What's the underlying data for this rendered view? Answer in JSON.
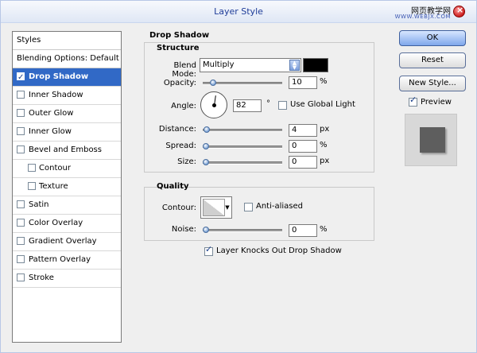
{
  "window": {
    "title": "Layer Style"
  },
  "watermark": {
    "chinese_text": "网页教学网",
    "url_text": "WWW.WEBJX.COM"
  },
  "styles_panel": {
    "header": "Styles",
    "blending_options": "Blending Options: Default",
    "items": [
      {
        "label": "Drop Shadow",
        "checked": true,
        "selected": true,
        "indent": false
      },
      {
        "label": "Inner Shadow",
        "checked": false,
        "selected": false,
        "indent": false
      },
      {
        "label": "Outer Glow",
        "checked": false,
        "selected": false,
        "indent": false
      },
      {
        "label": "Inner Glow",
        "checked": false,
        "selected": false,
        "indent": false
      },
      {
        "label": "Bevel and Emboss",
        "checked": false,
        "selected": false,
        "indent": false
      },
      {
        "label": "Contour",
        "checked": false,
        "selected": false,
        "indent": true
      },
      {
        "label": "Texture",
        "checked": false,
        "selected": false,
        "indent": true
      },
      {
        "label": "Satin",
        "checked": false,
        "selected": false,
        "indent": false
      },
      {
        "label": "Color Overlay",
        "checked": false,
        "selected": false,
        "indent": false
      },
      {
        "label": "Gradient Overlay",
        "checked": false,
        "selected": false,
        "indent": false
      },
      {
        "label": "Pattern Overlay",
        "checked": false,
        "selected": false,
        "indent": false
      },
      {
        "label": "Stroke",
        "checked": false,
        "selected": false,
        "indent": false
      }
    ]
  },
  "drop_shadow": {
    "title": "Drop Shadow",
    "structure": {
      "title": "Structure",
      "blend_mode": {
        "label": "Blend Mode:",
        "value": "Multiply"
      },
      "color": "#000000",
      "opacity": {
        "label": "Opacity:",
        "value": "10",
        "unit": "%",
        "slider_fraction": 0.1
      },
      "angle": {
        "label": "Angle:",
        "value": "82",
        "unit": "°",
        "degrees": 82
      },
      "use_global_light": {
        "label": "Use Global Light",
        "checked": false
      },
      "distance": {
        "label": "Distance:",
        "value": "4",
        "unit": "px",
        "slider_fraction": 0.01
      },
      "spread": {
        "label": "Spread:",
        "value": "0",
        "unit": "%",
        "slider_fraction": 0.0
      },
      "size": {
        "label": "Size:",
        "value": "0",
        "unit": "px",
        "slider_fraction": 0.0
      }
    },
    "quality": {
      "title": "Quality",
      "contour": {
        "label": "Contour:"
      },
      "anti_aliased": {
        "label": "Anti-aliased",
        "checked": false
      },
      "noise": {
        "label": "Noise:",
        "value": "0",
        "unit": "%",
        "slider_fraction": 0.0
      }
    },
    "layer_knocks_out": {
      "label": "Layer Knocks Out Drop Shadow",
      "checked": true
    }
  },
  "buttons": {
    "ok": "OK",
    "reset": "Reset",
    "new_style": "New Style..."
  },
  "preview": {
    "label": "Preview",
    "checked": true
  }
}
